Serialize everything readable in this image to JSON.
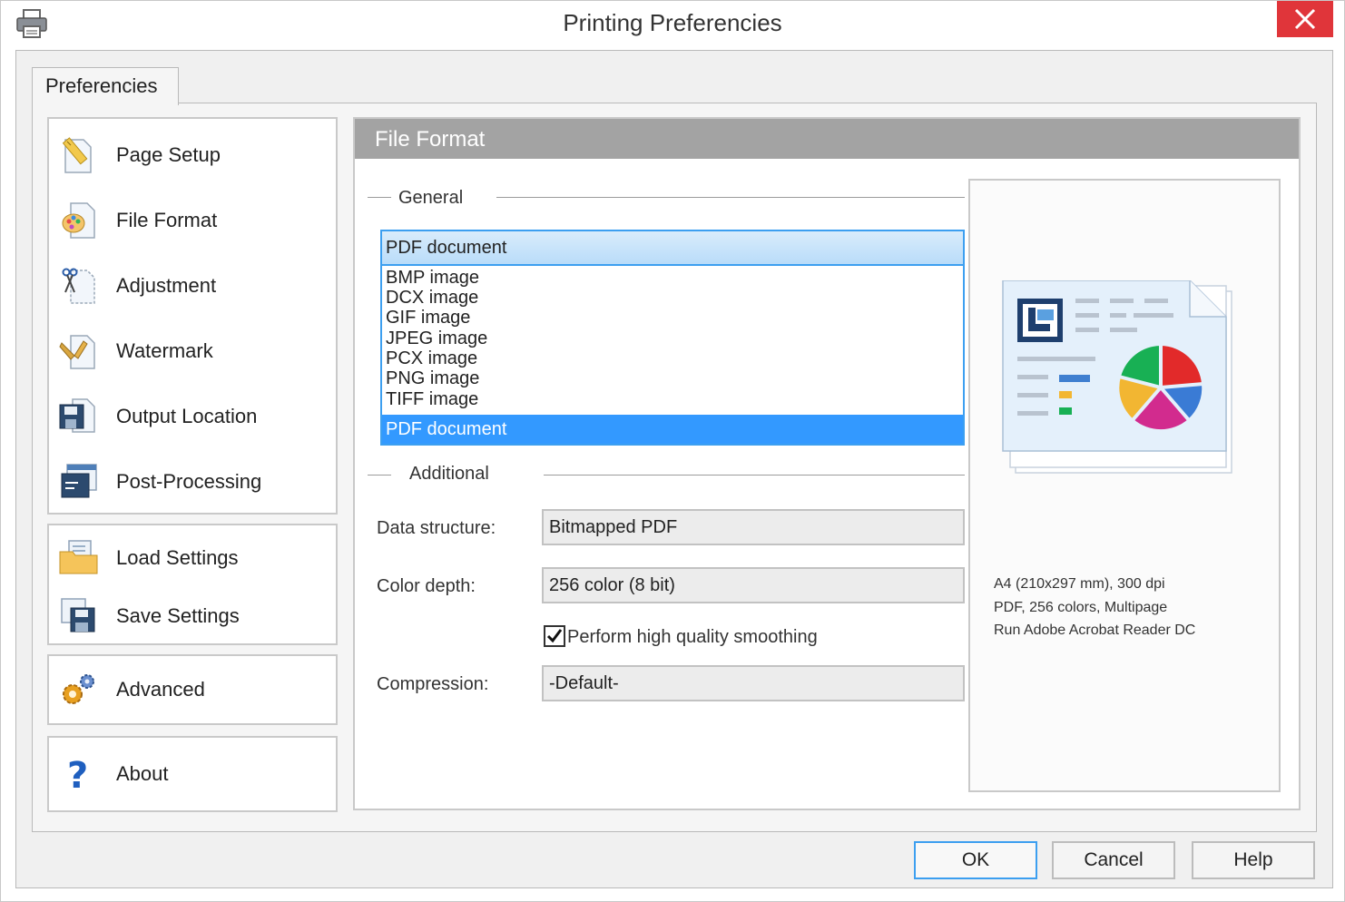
{
  "window": {
    "title": "Printing Preferencies"
  },
  "tab": {
    "label": "Preferencies"
  },
  "nav": {
    "main": [
      {
        "label": "Page Setup",
        "icon": "page-setup-icon"
      },
      {
        "label": "File Format",
        "icon": "file-format-icon"
      },
      {
        "label": "Adjustment",
        "icon": "adjustment-icon"
      },
      {
        "label": "Watermark",
        "icon": "watermark-icon"
      },
      {
        "label": "Output Location",
        "icon": "output-location-icon"
      },
      {
        "label": "Post-Processing",
        "icon": "post-processing-icon"
      }
    ],
    "settings": [
      {
        "label": "Load Settings",
        "icon": "load-settings-icon"
      },
      {
        "label": "Save Settings",
        "icon": "save-settings-icon"
      }
    ],
    "advanced": {
      "label": "Advanced",
      "icon": "advanced-gear-icon"
    },
    "about": {
      "label": "About",
      "icon": "help-question-icon"
    }
  },
  "panel": {
    "title": "File Format",
    "general_label": "General",
    "additional_label": "Additional",
    "format_combo": {
      "selected": "PDF document",
      "options": [
        "BMP image",
        "DCX image",
        "GIF image",
        "JPEG image",
        "PCX image",
        "PNG image",
        "TIFF image",
        "PDF document"
      ]
    },
    "data_structure": {
      "label": "Data structure:",
      "value": "Bitmapped PDF"
    },
    "color_depth": {
      "label": "Color depth:",
      "value": "256 color (8 bit)"
    },
    "smoothing": {
      "label": "Perform high quality smoothing",
      "checked": true
    },
    "compression": {
      "label": "Compression:",
      "value": "-Default-"
    }
  },
  "preview": {
    "line1": "A4 (210x297 mm), 300 dpi",
    "line2": "PDF, 256 colors, Multipage",
    "line3": "Run Adobe Acrobat Reader DC"
  },
  "buttons": {
    "ok": "OK",
    "cancel": "Cancel",
    "help": "Help"
  },
  "colors": {
    "accent": "#3399ff",
    "close": "#e0353a",
    "header": "#a3a3a3"
  }
}
